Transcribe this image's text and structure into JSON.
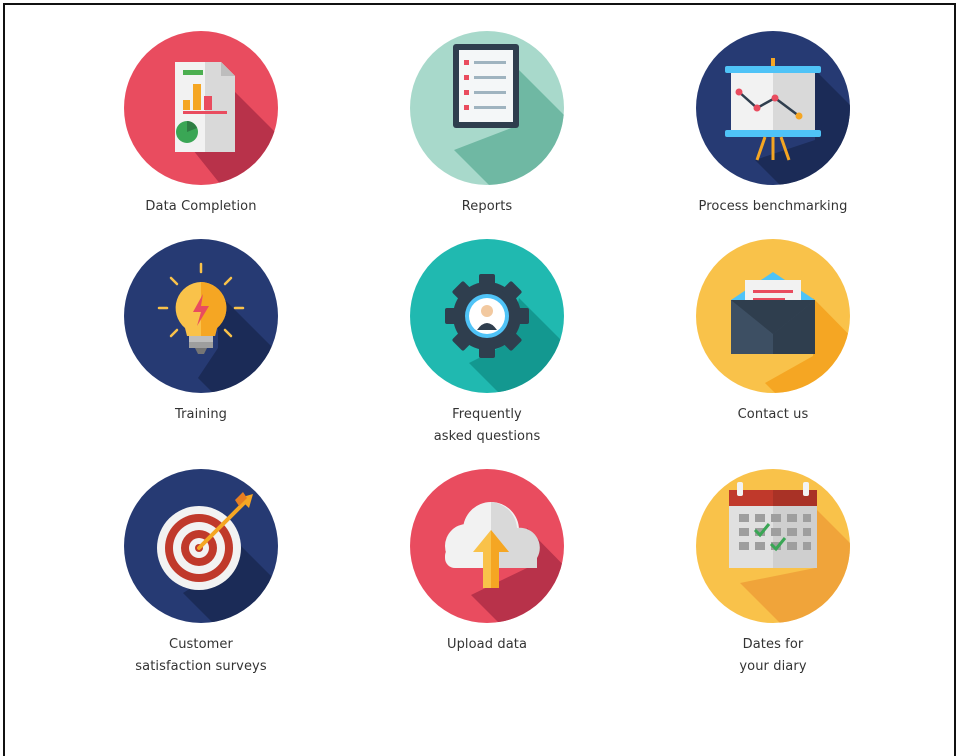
{
  "tiles": [
    {
      "id": "data-completion",
      "label": "Data Completion",
      "color": "#e94c5f",
      "icon": "report-chart-icon"
    },
    {
      "id": "reports",
      "label": "Reports",
      "color": "#a8d9cb",
      "icon": "clipboard-list-icon"
    },
    {
      "id": "process-benchmarking",
      "label": "Process benchmarking",
      "color": "#263a73",
      "icon": "presentation-board-icon"
    },
    {
      "id": "training",
      "label": "Training",
      "color": "#263a73",
      "icon": "lightbulb-icon"
    },
    {
      "id": "faq",
      "label": "Frequently\nasked questions",
      "color": "#20b9b0",
      "icon": "gear-user-icon"
    },
    {
      "id": "contact-us",
      "label": "Contact us",
      "color": "#f9c24a",
      "icon": "envelope-icon"
    },
    {
      "id": "customer-surveys",
      "label": "Customer\nsatisfaction surveys",
      "color": "#263a73",
      "icon": "target-arrow-icon"
    },
    {
      "id": "upload-data",
      "label": "Upload data",
      "color": "#e94c5f",
      "icon": "cloud-upload-icon"
    },
    {
      "id": "dates-diary",
      "label": "Dates for\nyour diary",
      "color": "#f9c24a",
      "icon": "calendar-icon"
    }
  ]
}
